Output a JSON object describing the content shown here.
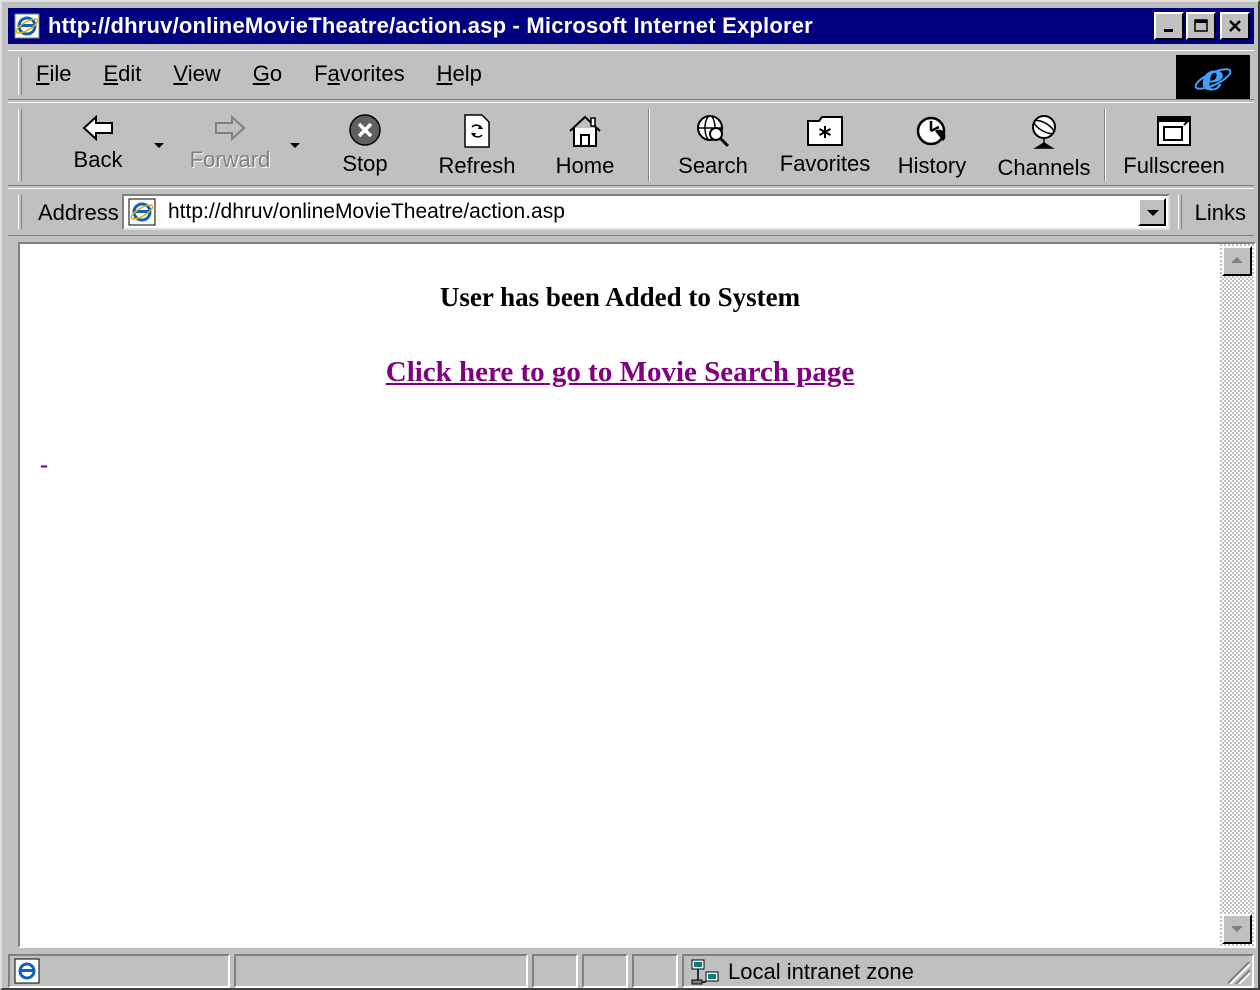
{
  "window": {
    "title": "http://dhruv/onlineMovieTheatre/action.asp - Microsoft Internet Explorer"
  },
  "menu": {
    "items": [
      {
        "pre": "",
        "key": "F",
        "post": "ile"
      },
      {
        "pre": "",
        "key": "E",
        "post": "dit"
      },
      {
        "pre": "",
        "key": "V",
        "post": "iew"
      },
      {
        "pre": "",
        "key": "G",
        "post": "o"
      },
      {
        "pre": "F",
        "key": "a",
        "post": "vorites"
      },
      {
        "pre": "",
        "key": "H",
        "post": "elp"
      }
    ]
  },
  "toolbar": {
    "back": "Back",
    "forward": "Forward",
    "stop": "Stop",
    "refresh": "Refresh",
    "home": "Home",
    "search": "Search",
    "favorites": "Favorites",
    "history": "History",
    "channels": "Channels",
    "fullscreen": "Fullscreen"
  },
  "address": {
    "label": "Address",
    "url": "http://dhruv/onlineMovieTheatre/action.asp",
    "links_label": "Links"
  },
  "page": {
    "message": "User has been Added to System",
    "link_text": "Click here to go to Movie Search page",
    "stray": "-"
  },
  "status": {
    "zone": "Local intranet zone"
  },
  "colors": {
    "title_bar": "#000080",
    "visited_link": "#800080",
    "chrome": "#c0c0c0"
  }
}
